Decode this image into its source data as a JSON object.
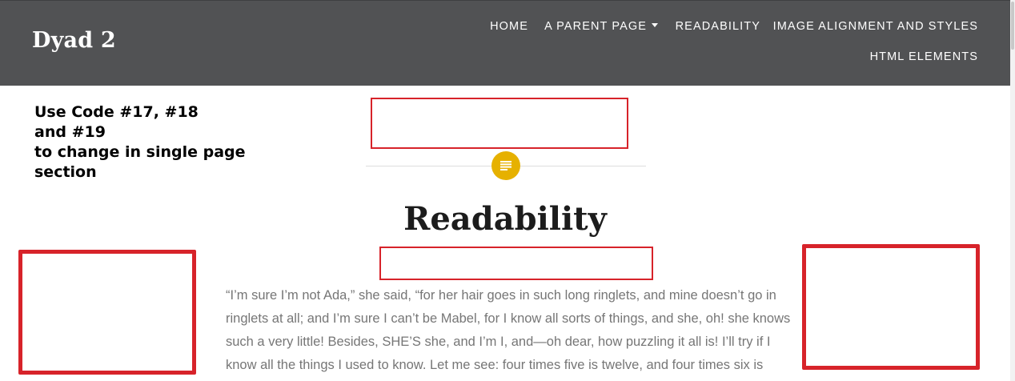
{
  "site": {
    "title": "Dyad 2"
  },
  "nav": {
    "items": [
      {
        "label": "HOME"
      },
      {
        "label": "A PARENT PAGE"
      },
      {
        "label": "READABILITY"
      },
      {
        "label": "IMAGE ALIGNMENT AND STYLES"
      },
      {
        "label": "HTML ELEMENTS"
      }
    ]
  },
  "note": "Use Code #17, #18\nand #19\nto change in single page\nsection",
  "icons": {
    "format": "document-lines-icon",
    "dropdown": "caret-down-icon"
  },
  "colors": {
    "header": "#515254",
    "badge": "#e6b100",
    "annotation": "#d7232a"
  },
  "post": {
    "title": "Readability",
    "lines": [
      "“I’m sure I’m not Ada,” she said, “for her hair goes in such long ringlets, and mine doesn’t go in",
      "ringlets at all; and I’m sure I can’t be Mabel, for I know all sorts of things, and she, oh! she knows",
      "such a very little! Besides, SHE’S she, and I’m I, and—oh dear, how puzzling it all is! I’ll try if I",
      "know all the things I used to know. Let me see: four times five is twelve, and four times six is"
    ]
  }
}
